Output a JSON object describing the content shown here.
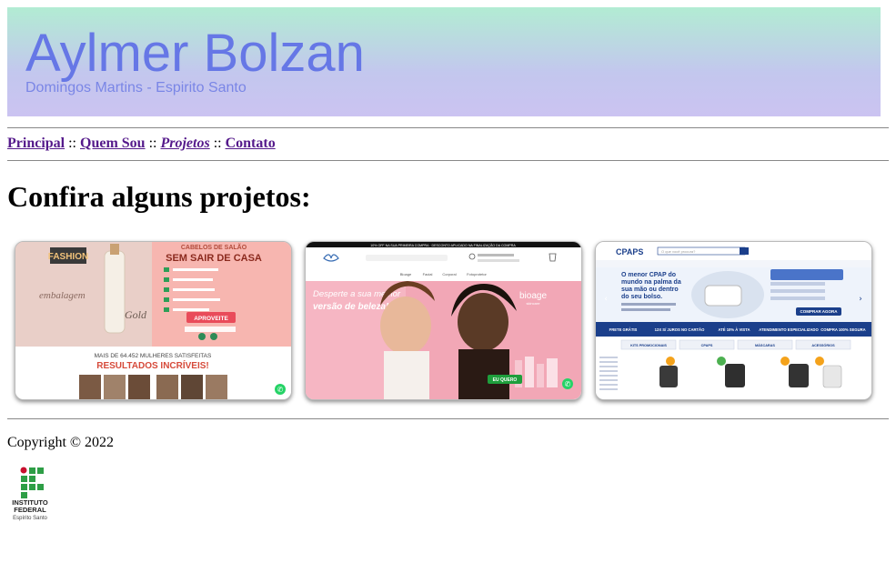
{
  "header": {
    "title": "Aylmer Bolzan",
    "subtitle": "Domingos Martins - Espirito Santo"
  },
  "nav": {
    "items": [
      {
        "label": "Principal"
      },
      {
        "label": "Quem Sou"
      },
      {
        "label": "Projetos"
      },
      {
        "label": "Contato"
      }
    ],
    "separator": "::"
  },
  "main": {
    "heading": "Confira alguns projetos:",
    "projects": [
      {
        "id": "fashion-gold",
        "brand": "FASHION",
        "brand_suffix": "GOLD",
        "headline_top": "CABELOS DE SALÃO",
        "headline": "SEM SAIR DE CASA",
        "cta": "APROVEITE",
        "stats_line": "MAIS DE 64.452 MULHERES SATISFEITAS",
        "results": "RESULTADOS INCRÍVEIS!"
      },
      {
        "id": "bioage",
        "promo_bar": "10% OFF NA SUA PRIMEIRA COMPRA · DESCONTO APLICADO NA FINALIZAÇÃO DA COMPRA",
        "nav_items": [
          "Bioage",
          "Facial",
          "Corporal",
          "Fotoprotetor"
        ],
        "hero_line1": "Desperte a sua melhor",
        "hero_line2": "versão de beleza!",
        "brand": "bioage",
        "brand_sub": "skincare",
        "cta": "EU QUERO"
      },
      {
        "id": "cpaps",
        "brand": "CPAPS",
        "search_placeholder": "O que você procura?",
        "hero_line1": "O menor CPAP do",
        "hero_line2": "mundo na palma da",
        "hero_line3": "sua mão ou dentro",
        "hero_line4": "do seu bolso.",
        "cta": "COMPRAR AGORA",
        "benefits": [
          "FRETE GRÁTIS",
          "12X S/ JUROS NO CARTÃO",
          "ATÉ 10% À VISTA",
          "ATENDIMENTO ESPECIALIZADO",
          "COMPRA 100% SEGURA"
        ],
        "tabs": [
          "KITS PROMOCIONAIS",
          "CPAPS",
          "MÁSCARAS",
          "ACESSÓRIOS"
        ]
      }
    ]
  },
  "footer": {
    "copyright": "Copyright © 2022",
    "logo_lines": [
      "INSTITUTO",
      "FEDERAL",
      "Espírito Santo"
    ]
  },
  "colors": {
    "title": "#6677e6",
    "link": "#551a8b",
    "header_top": "#b2ecd3",
    "header_bottom": "#cbc3f1"
  }
}
